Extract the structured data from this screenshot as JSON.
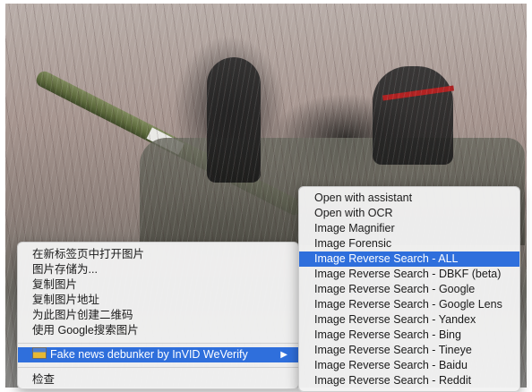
{
  "context_menu": {
    "items": [
      "在新标签页中打开图片",
      "图片存储为...",
      "复制图片",
      "复制图片地址",
      "为此图片创建二维码",
      "使用 Google搜索图片"
    ],
    "extension_item": "Fake news debunker by InVID WeVerify",
    "extension_icon": "invid-extension-icon",
    "submenu_arrow": "▶",
    "inspect": "检查"
  },
  "submenu": {
    "items": [
      "Open with assistant",
      "Open with OCR",
      "Image Magnifier",
      "Image Forensic",
      "Image Reverse Search - ALL",
      "Image Reverse Search - DBKF (beta)",
      "Image Reverse Search - Google",
      "Image Reverse Search - Google Lens",
      "Image Reverse Search - Yandex",
      "Image Reverse Search - Bing",
      "Image Reverse Search - Tineye",
      "Image Reverse Search - Baidu",
      "Image Reverse Search - Reddit"
    ],
    "highlighted_index": 4
  },
  "colors": {
    "highlight": "#2f6fdc",
    "menu_bg": "#f3f3f3"
  }
}
